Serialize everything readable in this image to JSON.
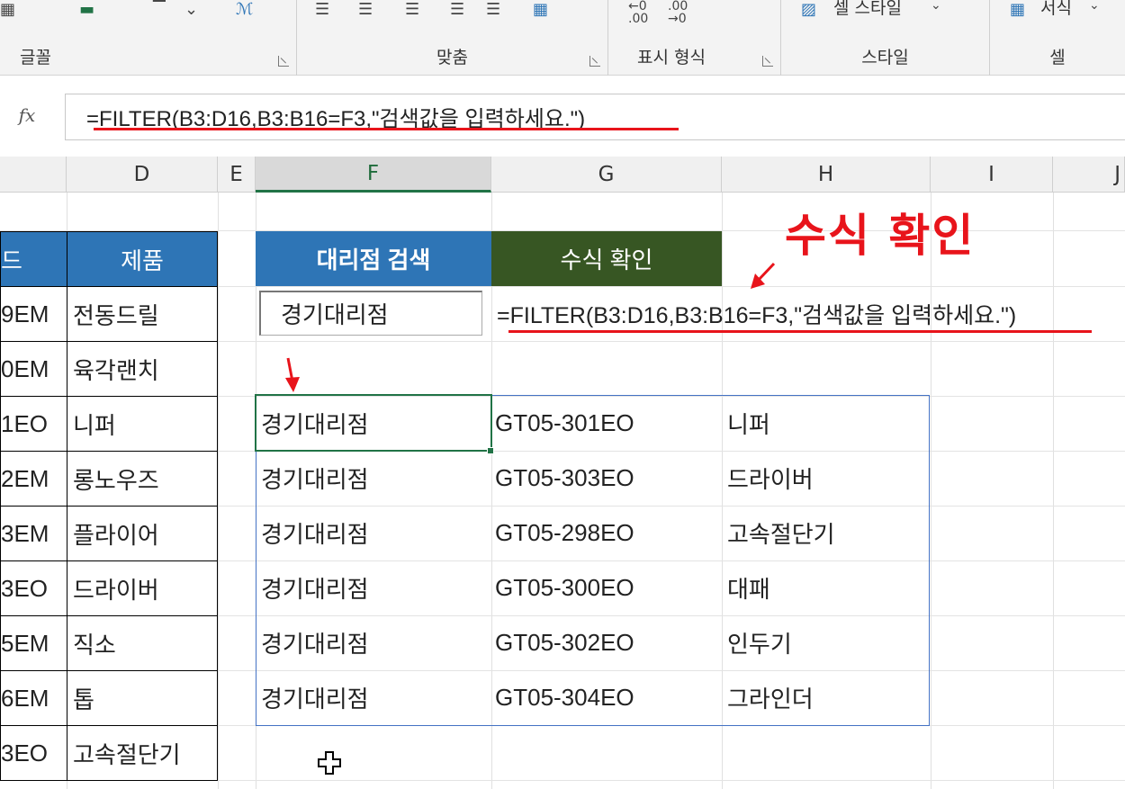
{
  "ribbon": {
    "groups": [
      {
        "label": "글꼴"
      },
      {
        "label": "맞춤"
      },
      {
        "label": "표시 형식"
      },
      {
        "label": "스타일"
      },
      {
        "label": "셀"
      }
    ],
    "cell_style_label": "셀 스타일",
    "format_label": "서식"
  },
  "formula_bar": {
    "fx_label": "fx",
    "formula": "=FILTER(B3:D16,B3:B16=F3,\"검색값을 입력하세요.\")"
  },
  "columns": [
    "D",
    "E",
    "F",
    "G",
    "H",
    "I",
    "J"
  ],
  "left_table": {
    "header_left": "드",
    "header_product": "제품",
    "rows": [
      {
        "code": "9EM",
        "product": "전동드릴"
      },
      {
        "code": "0EM",
        "product": "육각랜치"
      },
      {
        "code": "1EO",
        "product": "니퍼"
      },
      {
        "code": "2EM",
        "product": "롱노우즈"
      },
      {
        "code": "3EM",
        "product": "플라이어"
      },
      {
        "code": "3EO",
        "product": "드라이버"
      },
      {
        "code": "5EM",
        "product": "직소"
      },
      {
        "code": "6EM",
        "product": "톱"
      },
      {
        "code": "3EO",
        "product": "고속절단기"
      }
    ]
  },
  "search": {
    "header": "대리점 검색",
    "value": "경기대리점"
  },
  "formula_check": {
    "header": "수식 확인",
    "formula_text": "=FILTER(B3:D16,B3:B16=F3,\"검색값을 입력하세요.\")"
  },
  "annotation": {
    "title": "수식 확인",
    "color": "#e8141b"
  },
  "results": [
    {
      "dealer": "경기대리점",
      "code": "GT05-301EO",
      "product": "니퍼"
    },
    {
      "dealer": "경기대리점",
      "code": "GT05-303EO",
      "product": "드라이버"
    },
    {
      "dealer": "경기대리점",
      "code": "GT05-298EO",
      "product": "고속절단기"
    },
    {
      "dealer": "경기대리점",
      "code": "GT05-300EO",
      "product": "대패"
    },
    {
      "dealer": "경기대리점",
      "code": "GT05-302EO",
      "product": "인두기"
    },
    {
      "dealer": "경기대리점",
      "code": "GT05-304EO",
      "product": "그라인더"
    }
  ],
  "colors": {
    "header_blue": "#2e75b6",
    "header_green": "#375623",
    "selection_green": "#217346",
    "spill_border": "#4472c4"
  }
}
